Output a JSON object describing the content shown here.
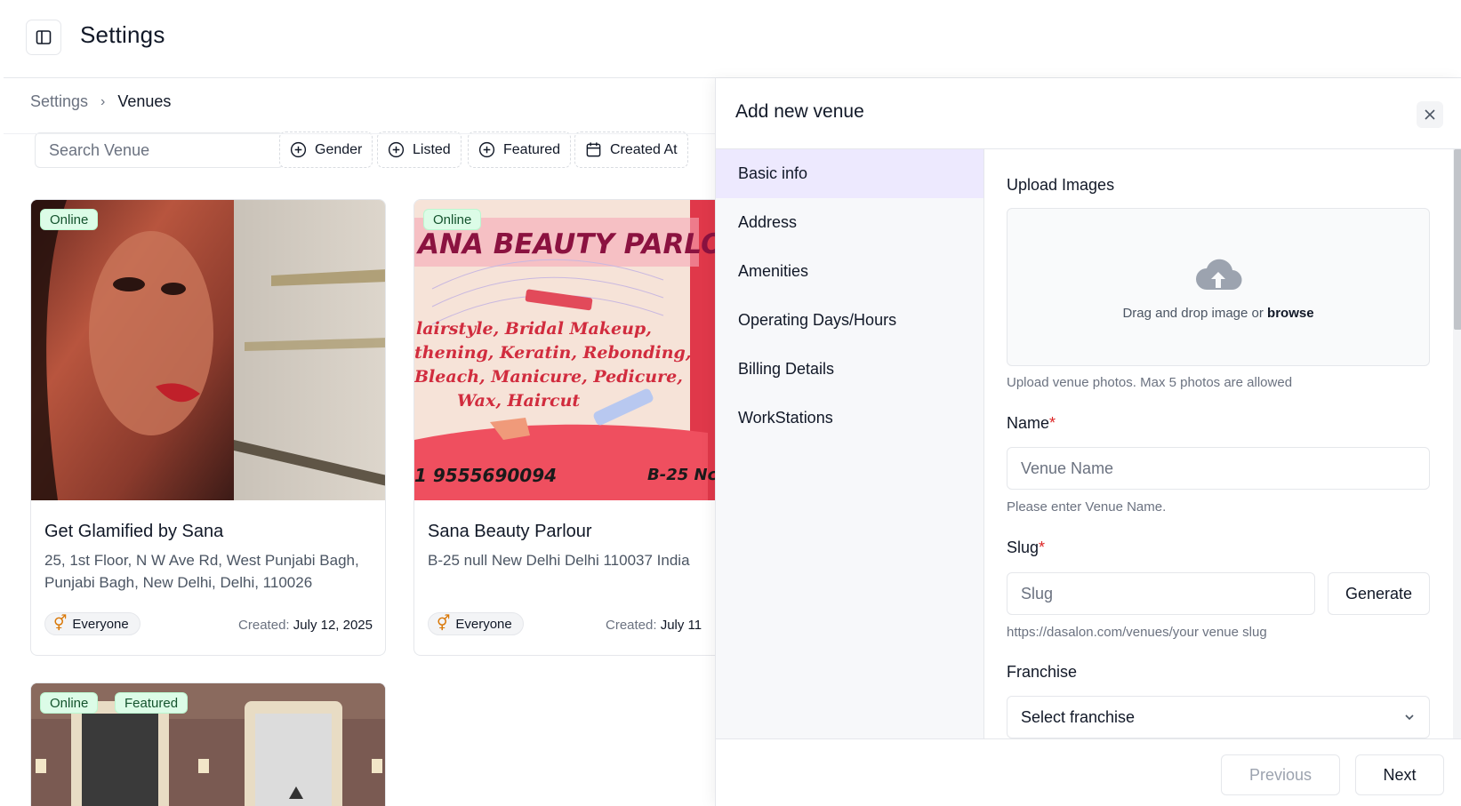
{
  "header": {
    "title": "Settings"
  },
  "breadcrumb": {
    "parent": "Settings",
    "separator": "›",
    "current": "Venues"
  },
  "filters": {
    "search_placeholder": "Search Venue",
    "buttons": [
      {
        "label": "Gender",
        "icon": "plus-circle-icon"
      },
      {
        "label": "Listed",
        "icon": "plus-circle-icon"
      },
      {
        "label": "Featured",
        "icon": "plus-circle-icon"
      },
      {
        "label": "Created At",
        "icon": "calendar-icon"
      }
    ]
  },
  "venues": [
    {
      "name": "Get Glamified by Sana",
      "address": "25, 1st Floor, N W Ave Rd, West Punjabi Bagh, Punjabi Bagh, New Delhi, Delhi, 110026",
      "badges": [
        "Online"
      ],
      "gender": "Everyone",
      "created_label": "Created:",
      "created_date": "July 12, 2025"
    },
    {
      "name": "Sana Beauty Parlour",
      "address": "B-25 null New Delhi Delhi 110037 India",
      "badges": [
        "Online"
      ],
      "gender": "Everyone",
      "created_label": "Created:",
      "created_date": "July 11",
      "image_text": {
        "banner": "ANA BEAUTY PARLOUR",
        "services": [
          "lairstyle, Bridal Makeup,",
          "thening, Keratin, Rebonding,",
          "Bleach, Manicure, Pedicure,",
          "Wax, Haircut"
        ],
        "phone": "1 9555690094",
        "location": "B-25 Nc"
      }
    },
    {
      "badges": [
        "Online",
        "Featured"
      ]
    }
  ],
  "drawer": {
    "title": "Add new venue",
    "steps": [
      "Basic info",
      "Address",
      "Amenities",
      "Operating Days/Hours",
      "Billing Details",
      "WorkStations"
    ],
    "active_step": 0,
    "upload": {
      "label": "Upload Images",
      "drop_text": "Drag and drop image or",
      "browse": "browse",
      "help": "Upload venue photos. Max 5 photos are allowed"
    },
    "name": {
      "label": "Name",
      "required": "*",
      "placeholder": "Venue Name",
      "help": "Please enter Venue Name."
    },
    "slug": {
      "label": "Slug",
      "required": "*",
      "placeholder": "Slug",
      "generate": "Generate",
      "help": "https://dasalon.com/venues/your venue slug"
    },
    "franchise": {
      "label": "Franchise",
      "placeholder": "Select franchise"
    },
    "footer": {
      "previous": "Previous",
      "next": "Next"
    }
  },
  "colors": {
    "accent_active": "#ede9fe",
    "badge_bg": "#dcfce7",
    "required": "#dc2626"
  }
}
